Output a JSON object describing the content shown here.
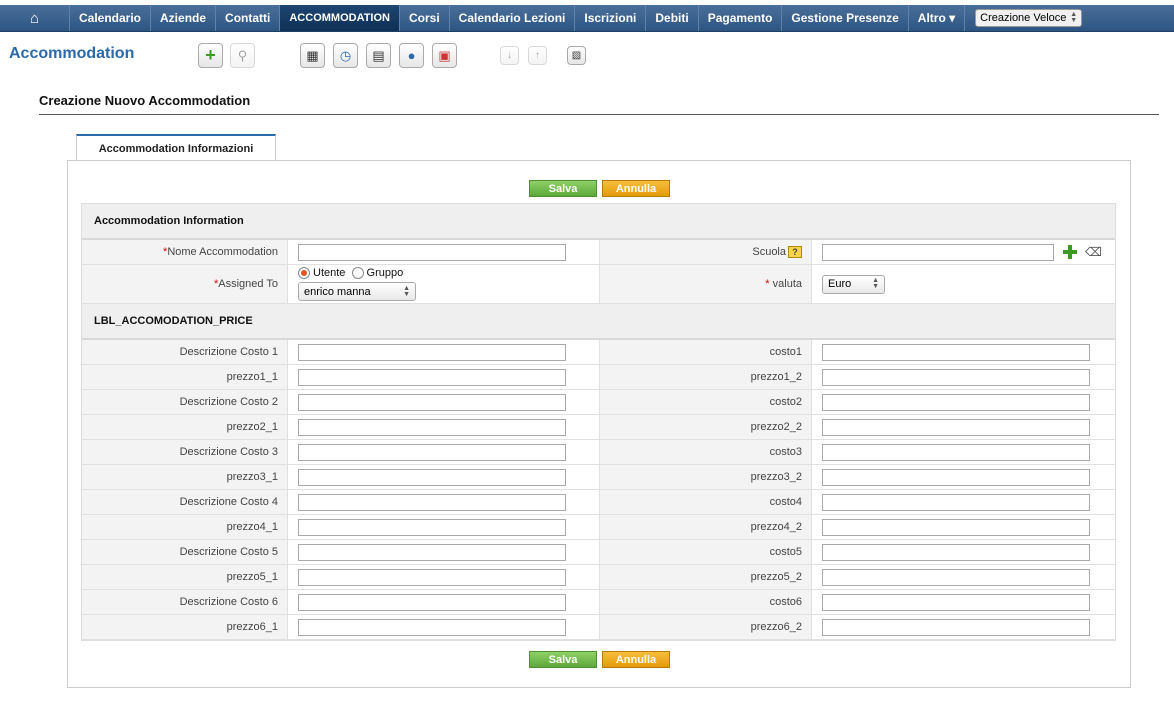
{
  "nav": {
    "home_icon": "home-icon",
    "items": [
      "Calendario",
      "Aziende",
      "Contatti",
      "ACCOMMODATION",
      "Corsi",
      "Calendario Lezioni",
      "Iscrizioni",
      "Debiti",
      "Pagamento",
      "Gestione Presenze",
      "Altro ▾"
    ],
    "active": "ACCOMMODATION",
    "quick_create": "Creazione Veloce"
  },
  "module": {
    "title": "Accommodation"
  },
  "page": {
    "title": "Creazione Nuovo Accommodation",
    "tab": "Accommodation Informazioni"
  },
  "buttons": {
    "save": "Salva",
    "cancel": "Annulla"
  },
  "sections": {
    "info": "Accommodation Information",
    "price": "LBL_ACCOMODATION_PRICE"
  },
  "fields": {
    "nome": "Nome Accommodation",
    "scuola": "Scuola",
    "scuola_badge": "?",
    "assigned": "Assigned To",
    "valuta": "valuta",
    "valuta_value": "Euro",
    "radio_user": "Utente",
    "radio_group": "Gruppo",
    "assigned_value": "enrico manna"
  },
  "price_rows": [
    {
      "left": "Descrizione Costo 1",
      "right": "costo1"
    },
    {
      "left": "prezzo1_1",
      "right": "prezzo1_2"
    },
    {
      "left": "Descrizione Costo 2",
      "right": "costo2"
    },
    {
      "left": "prezzo2_1",
      "right": "prezzo2_2"
    },
    {
      "left": "Descrizione Costo 3",
      "right": "costo3"
    },
    {
      "left": "prezzo3_1",
      "right": "prezzo3_2"
    },
    {
      "left": "Descrizione Costo 4",
      "right": "costo4"
    },
    {
      "left": "prezzo4_1",
      "right": "prezzo4_2"
    },
    {
      "left": "Descrizione Costo 5",
      "right": "costo5"
    },
    {
      "left": "prezzo5_1",
      "right": "prezzo5_2"
    },
    {
      "left": "Descrizione Costo 6",
      "right": "costo6"
    },
    {
      "left": "prezzo6_1",
      "right": "prezzo6_2"
    }
  ],
  "colors": {
    "nav": "#2e5582",
    "accent": "#2b6aa8",
    "save": "#6bb544",
    "cancel": "#e9a416",
    "required": "#dd0000"
  }
}
